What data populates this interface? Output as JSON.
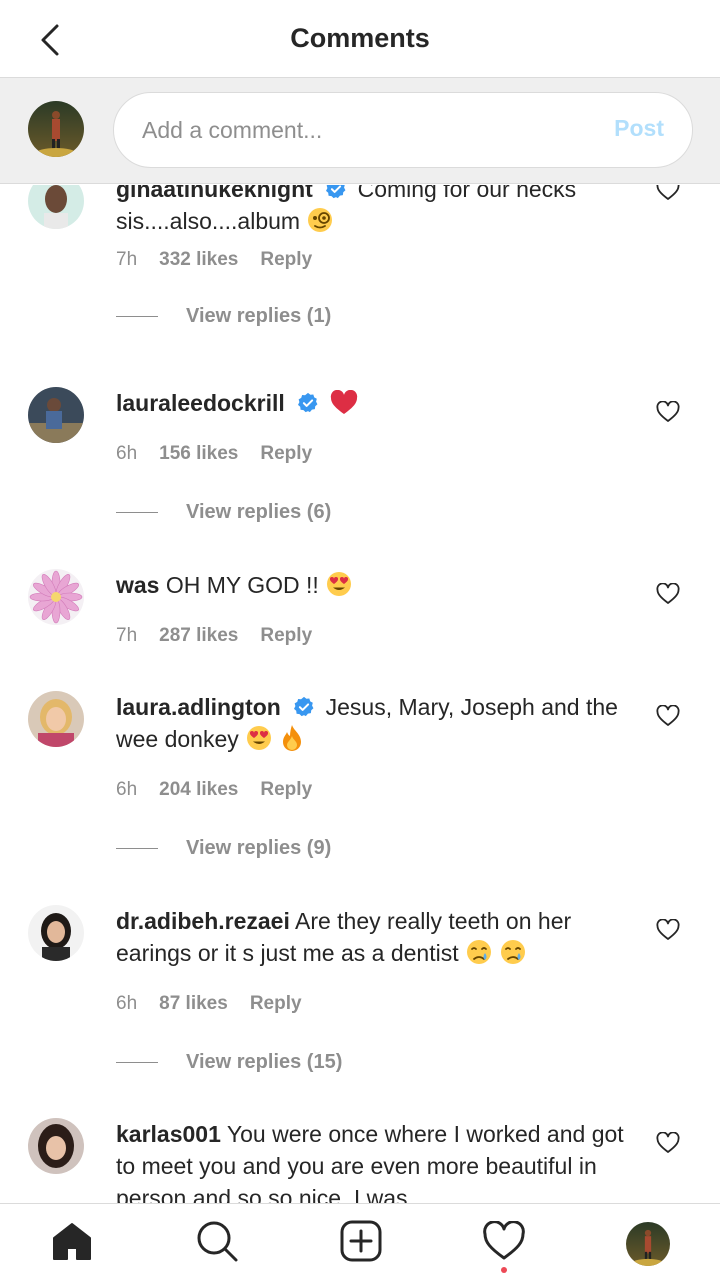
{
  "header": {
    "title": "Comments"
  },
  "composer": {
    "placeholder": "Add a comment...",
    "post_label": "Post"
  },
  "comments": [
    {
      "username": "ginaatinukeknight",
      "verified": true,
      "text": "Coming for our necks sis....also....album",
      "emoji": "monocle-face",
      "time": "7h",
      "likes": "332 likes",
      "reply": "Reply",
      "view_replies": "View replies (1)"
    },
    {
      "username": "lauraleedockrill",
      "verified": true,
      "text": "",
      "emoji": "red-heart",
      "time": "6h",
      "likes": "156 likes",
      "reply": "Reply",
      "view_replies": "View replies (6)"
    },
    {
      "username": "was",
      "verified": false,
      "text": "OH MY GOD !!",
      "emoji": "heart-eyes",
      "time": "7h",
      "likes": "287 likes",
      "reply": "Reply"
    },
    {
      "username": "laura.adlington",
      "verified": true,
      "text": "Jesus, Mary, Joseph and the wee donkey",
      "emoji": "heart-eyes, fire",
      "time": "6h",
      "likes": "204 likes",
      "reply": "Reply",
      "view_replies": "View replies (9)"
    },
    {
      "username": "dr.adibeh.rezaei",
      "verified": false,
      "text": "Are they really teeth on her earings or it s just me as a dentist",
      "emoji": "crying-face, crying-face",
      "time": "6h",
      "likes": "87 likes",
      "reply": "Reply",
      "view_replies": "View replies (15)"
    },
    {
      "username": "karlas001",
      "verified": false,
      "text": "You were once where I worked and got to meet you and you are even more beautiful in person and so so nice. I was"
    }
  ],
  "nav": {
    "items": [
      "home-icon",
      "search-icon",
      "new-post-icon",
      "activity-icon",
      "profile-avatar"
    ],
    "active": "home-icon",
    "has_notification": true
  },
  "colors": {
    "accent": "#3897f0",
    "post_disabled": "#b2dffc",
    "muted": "#8e8e8e",
    "text": "#262626",
    "composer_bg": "#efefef",
    "notification": "#ed4956"
  }
}
